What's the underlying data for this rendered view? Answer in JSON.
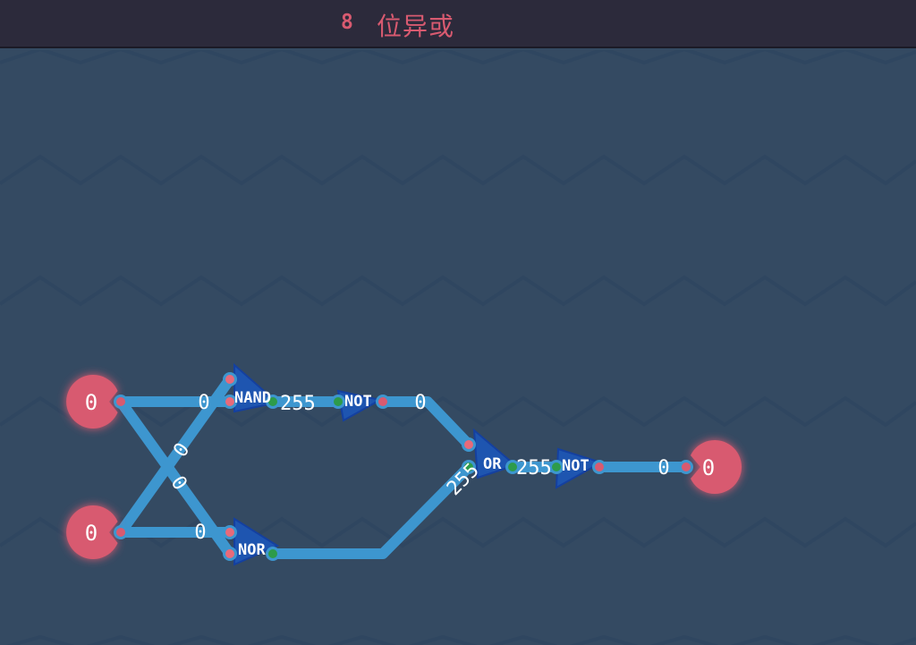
{
  "header": {
    "level_number": "8",
    "level_title": "位异或"
  },
  "colors": {
    "background": "#344a62",
    "header": "#2c2a3b",
    "accent": "#d85a70",
    "wire": "#3d96cf",
    "gate": "#1e55b0",
    "pin_output": "#2d9b4a",
    "pin_input": "#d85a70"
  },
  "circuit": {
    "inputs": [
      {
        "name": "input-a",
        "value": "0"
      },
      {
        "name": "input-b",
        "value": "0"
      }
    ],
    "output": {
      "value": "0"
    },
    "gates": [
      {
        "label": "NAND"
      },
      {
        "label": "NOT"
      },
      {
        "label": "NOR"
      },
      {
        "label": "OR"
      },
      {
        "label": "NOT"
      }
    ],
    "wire_values": {
      "a_to_nand": "0",
      "b_to_nor": "0",
      "cross_1": "0",
      "cross_2": "0",
      "nand_to_not": "255",
      "not_to_or": "0",
      "nor_to_or": "255",
      "or_to_not": "255",
      "not_to_output": "0"
    }
  }
}
